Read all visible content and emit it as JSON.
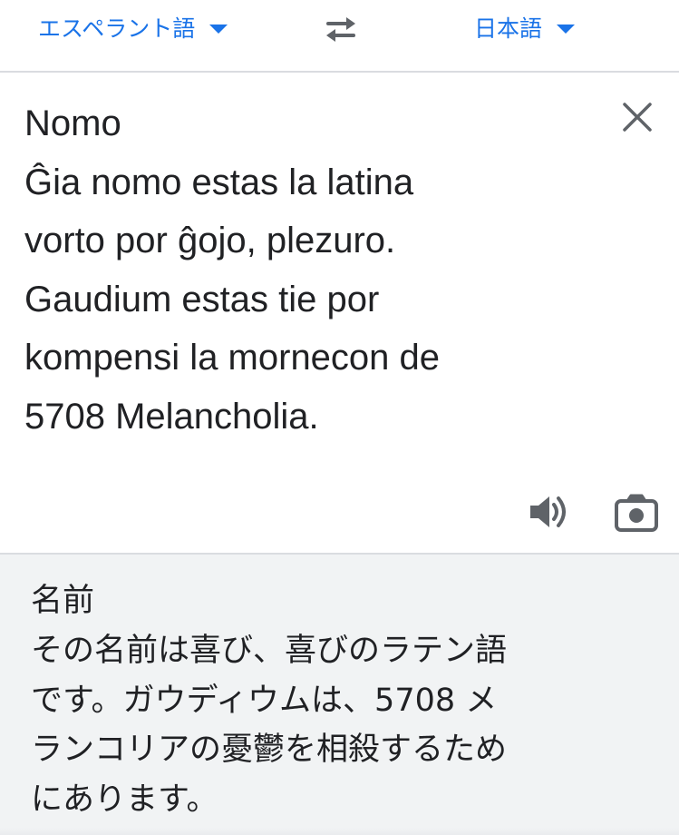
{
  "language_bar": {
    "source_language": "エスペラント語",
    "target_language": "日本語",
    "swap_icon": "swap-arrows-icon",
    "dropdown_icon": "caret-down-icon"
  },
  "source": {
    "lines": [
      "Nomo",
      "Ĝia nomo estas la latina",
      "vorto por ĝojo, plezuro.",
      "Gaudium estas tie por",
      "kompensi la mornecon de",
      "5708 Melancholia."
    ],
    "clear_icon": "close-icon",
    "speaker_icon": "speaker-icon",
    "camera_icon": "camera-icon"
  },
  "translation": {
    "lines": [
      "名前",
      "その名前は喜び、喜びのラテン語",
      "です。ガウディウムは、5708 メ",
      "ランコリアの憂鬱を相殺するため",
      "にあります。"
    ]
  },
  "colors": {
    "accent": "#1a73e8",
    "text": "#202124",
    "icon": "#5f6368",
    "divider": "#dadce0",
    "translation_bg": "#f1f3f4"
  }
}
